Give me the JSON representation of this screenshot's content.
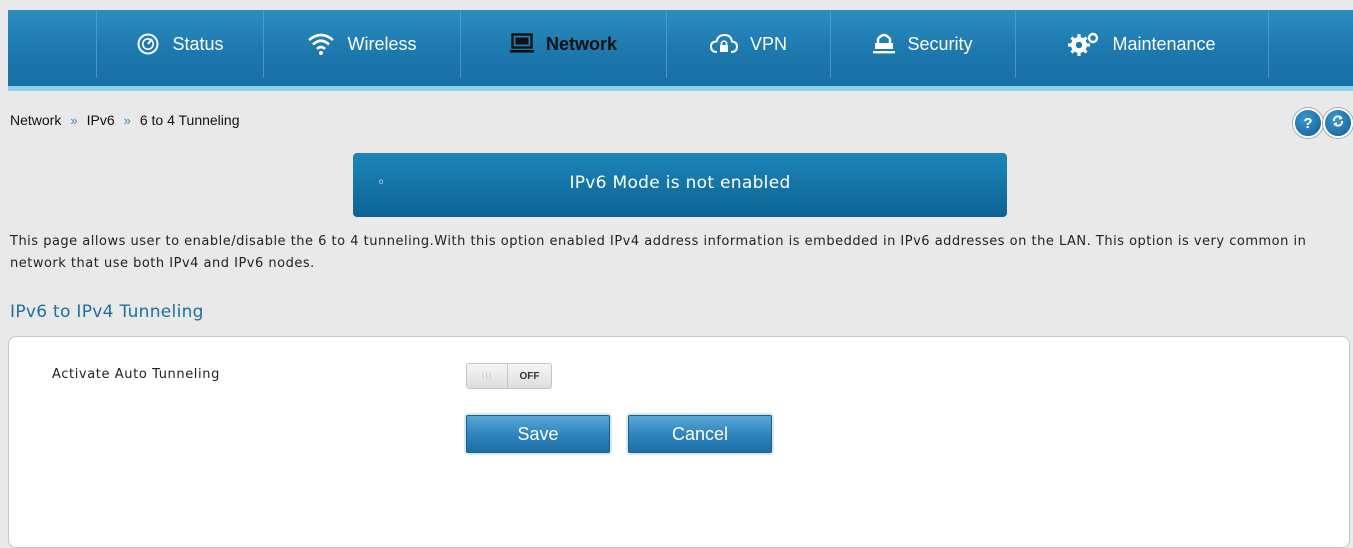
{
  "nav": {
    "items": [
      {
        "label": "Status",
        "icon": "speedometer-icon",
        "active": false
      },
      {
        "label": "Wireless",
        "icon": "wifi-icon",
        "active": false
      },
      {
        "label": "Network",
        "icon": "computer-icon",
        "active": true
      },
      {
        "label": "VPN",
        "icon": "cloud-lock-icon",
        "active": false
      },
      {
        "label": "Security",
        "icon": "lock-icon",
        "active": false
      },
      {
        "label": "Maintenance",
        "icon": "gears-icon",
        "active": false
      }
    ]
  },
  "breadcrumb": {
    "items": [
      "Network",
      "IPv6",
      "6 to 4 Tunneling"
    ],
    "separator": "»"
  },
  "top_icons": {
    "help": "?",
    "refresh": "refresh-icon"
  },
  "banner": {
    "bullet": "◦",
    "text": "IPv6 Mode is not enabled"
  },
  "description": "This page allows user to enable/disable the 6 to 4 tunneling.With this option enabled IPv4 address information is embedded in IPv6 addresses on the LAN. This option is very common in network that use both IPv4 and IPv6 nodes.",
  "section_title": "IPv6 to IPv4 Tunneling",
  "form": {
    "auto_tunneling_label": "Activate Auto Tunneling",
    "toggle_knob": "III",
    "toggle_state": "OFF",
    "save_label": "Save",
    "cancel_label": "Cancel"
  },
  "colors": {
    "nav_bg": "#1d78ad",
    "nav_strip": "#8fd0f5",
    "banner_bg": "#0d6293",
    "section_title": "#1d6fa0",
    "button_bg": "#2f86be"
  }
}
